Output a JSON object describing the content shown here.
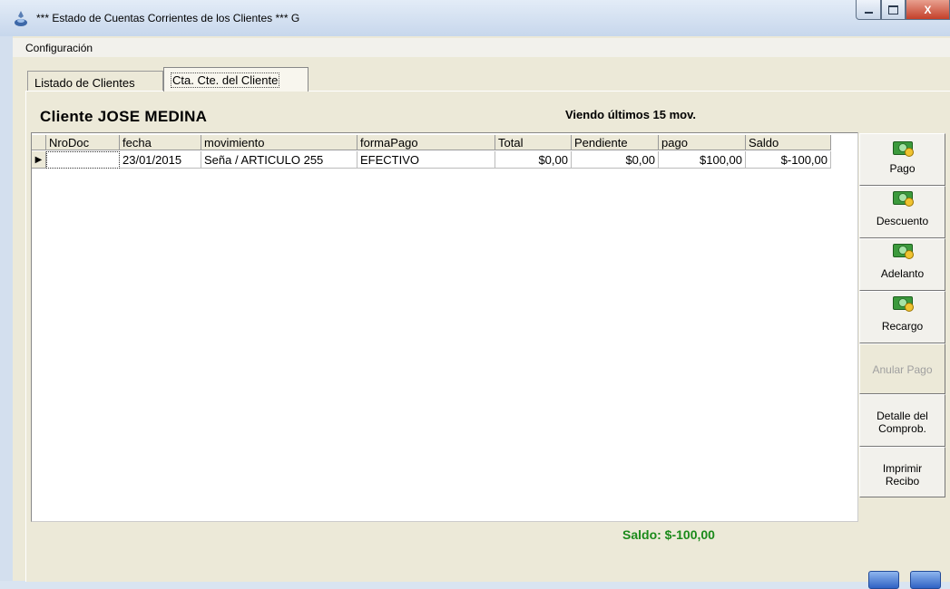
{
  "window": {
    "title": "*** Estado de Cuentas Corrientes de los Clientes *** G",
    "close_label": "X"
  },
  "menu": {
    "items": [
      "Configuración"
    ]
  },
  "tabs": [
    {
      "label": "Listado de Clientes",
      "active": false
    },
    {
      "label": "Cta. Cte. del Cliente",
      "active": true
    }
  ],
  "client": {
    "name_label": "Cliente JOSE MEDINA",
    "viewing_label": "Viendo últimos 15 mov."
  },
  "grid": {
    "columns": [
      "NroDoc",
      "fecha",
      "movimiento",
      "formaPago",
      "Total",
      "Pendiente",
      "pago",
      "Saldo"
    ],
    "rows": [
      [
        "",
        "23/01/2015",
        "Seña / ARTICULO 255",
        "EFECTIVO",
        "$0,00",
        "$0,00",
        "$100,00",
        "$-100,00"
      ]
    ]
  },
  "buttons": {
    "pago": "Pago",
    "descuento": "Descuento",
    "adelanto": "Adelanto",
    "recargo": "Recargo",
    "anular_pago": "Anular Pago",
    "detalle_line1": "Detalle del",
    "detalle_line2": "Comprob.",
    "imprimir_line1": "Imprimir",
    "imprimir_line2": "Recibo"
  },
  "footer": {
    "saldo_label": "Saldo: $-100,00"
  },
  "colors": {
    "saldo": "#1a8a1a",
    "disabled_text": "#a0a0a0"
  }
}
